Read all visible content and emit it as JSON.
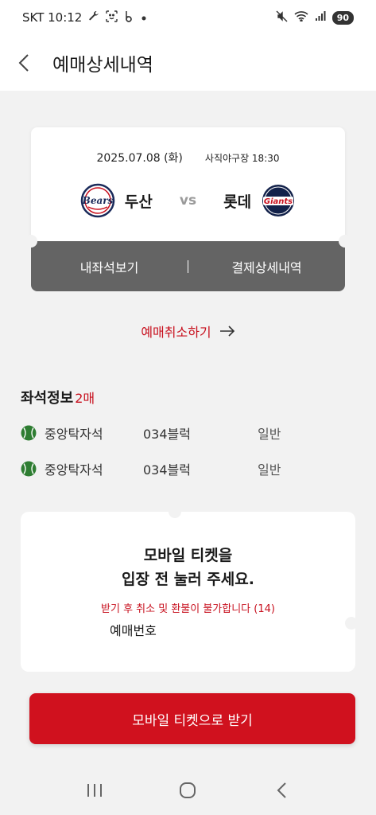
{
  "status_bar": {
    "carrier_time": "SKT 10:12",
    "extra_icons": [
      "wrench-icon",
      "face-scan-icon",
      "b-app-icon",
      "dot-icon"
    ],
    "battery": "90"
  },
  "header": {
    "title": "예매상세내역"
  },
  "ticket": {
    "date": "2025.07.08 (화)",
    "venue_time": "사직야구장 18:30",
    "home_team": "두산",
    "away_team": "롯데",
    "vs": "vs",
    "view_seat_label": "내좌석보기",
    "payment_detail_label": "결제상세내역",
    "colors": {
      "bottom_bar": "#646464"
    }
  },
  "cancel": {
    "label": "예매취소하기"
  },
  "seats": {
    "heading": "좌석정보",
    "count": "2매",
    "rows": [
      {
        "zone": "중앙탁자석",
        "block": "034블럭",
        "grade": "일반"
      },
      {
        "zone": "중앙탁자석",
        "block": "034블럭",
        "grade": "일반"
      }
    ]
  },
  "mobile_ticket": {
    "line1": "모바일 티켓을",
    "line2": "입장 전 눌러 주세요.",
    "warning": "받기 후 취소 및 환불이 불가합니다 (14)",
    "reservation_label": "예매번호"
  },
  "cta": {
    "label": "모바일 티켓으로 받기",
    "color": "#d0111e"
  },
  "accent_color": "#c8101e"
}
